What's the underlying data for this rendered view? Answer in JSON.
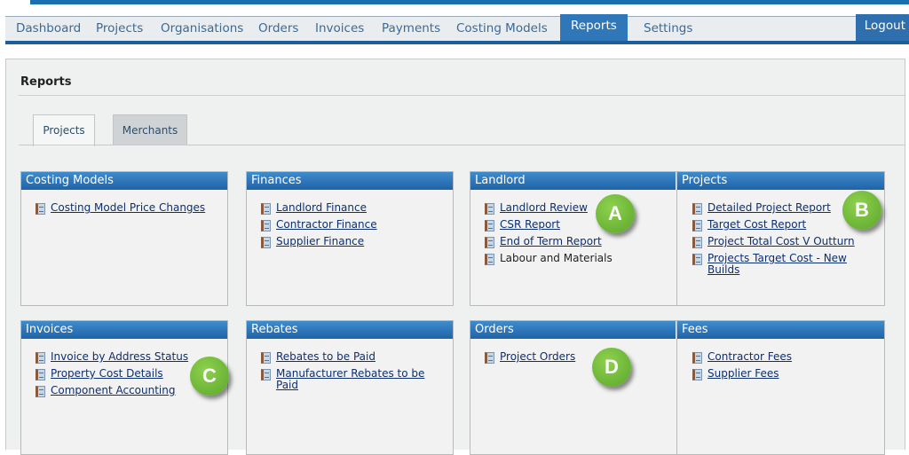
{
  "nav": {
    "items": [
      {
        "label": "Dashboard"
      },
      {
        "label": "Projects"
      },
      {
        "label": "Organisations"
      },
      {
        "label": "Orders"
      },
      {
        "label": "Invoices"
      },
      {
        "label": "Payments"
      },
      {
        "label": "Costing Models"
      },
      {
        "label": "Reports",
        "active": true
      },
      {
        "label": "Settings"
      }
    ],
    "logout": "Logout"
  },
  "page": {
    "title": "Reports"
  },
  "tabs": [
    {
      "label": "Projects",
      "active": true
    },
    {
      "label": "Merchants"
    }
  ],
  "panels": {
    "costing_models": {
      "title": "Costing Models",
      "links": [
        "Costing Model Price Changes"
      ]
    },
    "finances": {
      "title": "Finances",
      "links": [
        "Landlord Finance",
        "Contractor Finance",
        "Supplier Finance"
      ]
    },
    "landlord": {
      "title": "Landlord",
      "links": [
        "Landlord Review",
        "CSR Report",
        "End of Term Report"
      ],
      "plain": [
        "Labour and Materials"
      ]
    },
    "projects": {
      "title": "Projects",
      "links": [
        "Detailed Project Report",
        "Target Cost Report",
        "Project Total Cost V Outturn",
        "Projects Target Cost - New Builds"
      ]
    },
    "invoices": {
      "title": "Invoices",
      "links": [
        "Invoice by Address Status",
        "Property Cost Details",
        "Component Accounting"
      ]
    },
    "rebates": {
      "title": "Rebates",
      "links": [
        "Rebates to be Paid",
        "Manufacturer Rebates to be Paid"
      ]
    },
    "orders": {
      "title": "Orders",
      "links": [
        "Project Orders"
      ]
    },
    "fees": {
      "title": "Fees",
      "links": [
        "Contractor Fees",
        "Supplier Fees"
      ]
    }
  },
  "markers": {
    "a": "A",
    "b": "B",
    "c": "C",
    "d": "D"
  },
  "colors": {
    "nav_active": "#2f77b8",
    "panel_header": "#1f62a8",
    "marker": "#6cb534",
    "link": "#0d2f70"
  }
}
